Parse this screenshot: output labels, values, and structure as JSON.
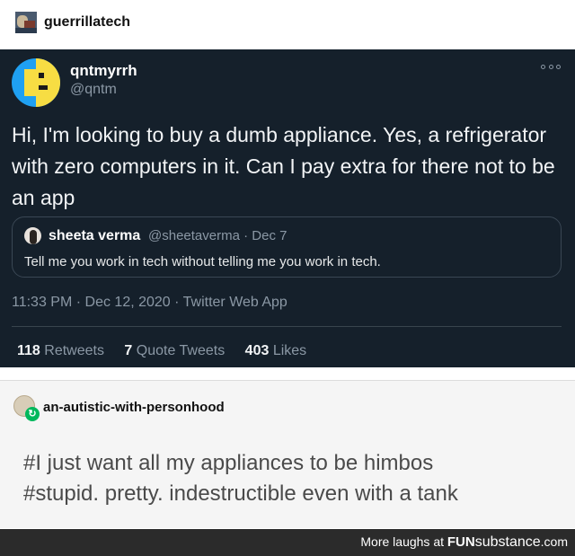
{
  "post": {
    "username": "guerrillatech"
  },
  "tweet": {
    "display_name": "qntmyrrh",
    "handle": "@qntm",
    "text": "Hi, I'm looking to buy a dumb appliance. Yes, a refrigerator with zero computers in it. Can I pay extra for there not to be an app",
    "quoted": {
      "name": "sheeta verma",
      "handle_date": "@sheetaverma · Dec 7",
      "text": "Tell me you work in tech without telling me you work in tech."
    },
    "meta": "11:33 PM · Dec 12, 2020 · Twitter Web App",
    "stats": [
      {
        "count": "118",
        "label": "Retweets"
      },
      {
        "count": "7",
        "label": "Quote Tweets"
      },
      {
        "count": "403",
        "label": "Likes"
      }
    ]
  },
  "reblog": {
    "username": "an-autistic-with-personhood",
    "tags": [
      "#I just want all my appliances to be himbos",
      "#stupid. pretty. indestructible even with a tank"
    ]
  },
  "footer": {
    "lead": "More laughs at",
    "brand_a": "FUN",
    "brand_b": "substance",
    "brand_c": ".com"
  }
}
